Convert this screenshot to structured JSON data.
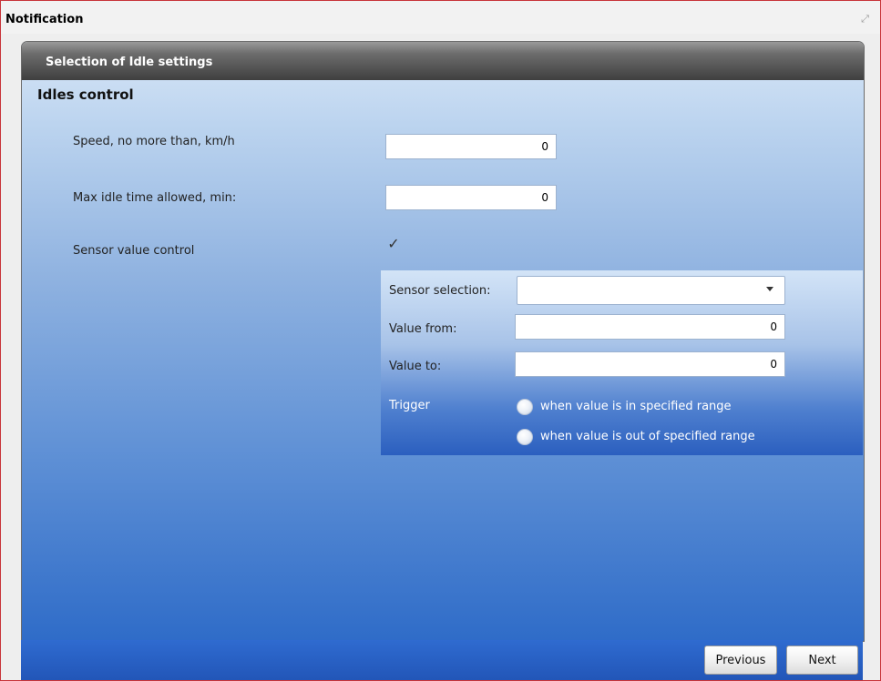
{
  "window": {
    "title": "Notification",
    "close_icon": "close-icon"
  },
  "panel": {
    "header": "Selection of Idle settings",
    "section_title": "Idles control",
    "speed": {
      "label": "Speed, no more than, km/h",
      "value": "0"
    },
    "max_idle": {
      "label": "Max idle time allowed, min:",
      "value": "0"
    },
    "sensor_control": {
      "label": "Sensor value control",
      "checked": true,
      "check_glyph": "✓"
    },
    "sensor_panel": {
      "sensor_selection": {
        "label": "Sensor selection:",
        "value": ""
      },
      "value_from": {
        "label": "Value from:",
        "value": "0"
      },
      "value_to": {
        "label": "Value to:",
        "value": "0"
      },
      "trigger": {
        "label": "Trigger",
        "options": [
          "when value is in specified range",
          "when value is out of specified range"
        ]
      }
    }
  },
  "footer": {
    "previous_label": "Previous",
    "next_label": "Next"
  },
  "colors": {
    "window_border": "#c8353a",
    "header_dark": "#3f3f3f",
    "footer_blue": "#2256b8"
  }
}
